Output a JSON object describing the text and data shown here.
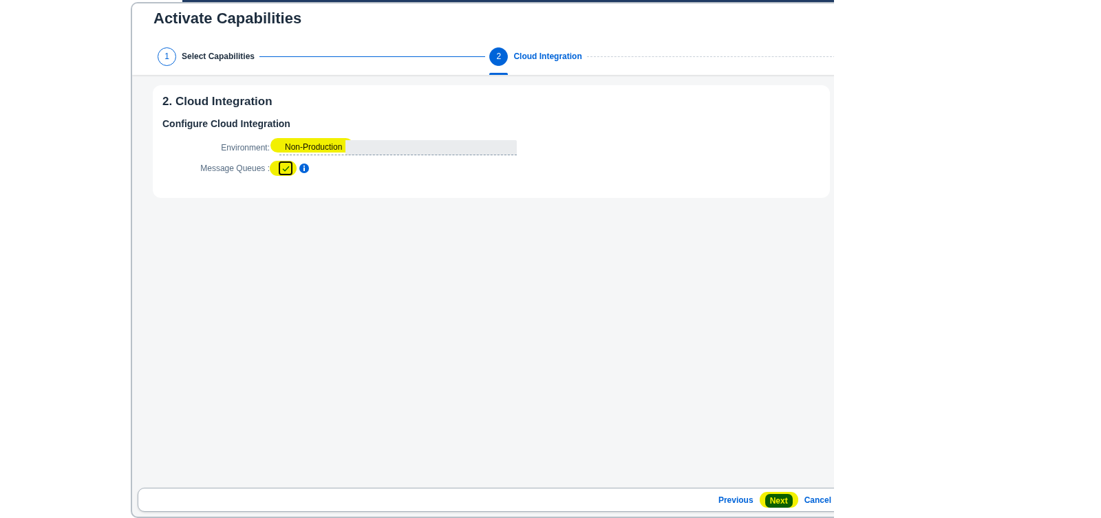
{
  "dialog": {
    "title": "Activate Capabilities"
  },
  "wizard": {
    "steps": [
      {
        "number": "1",
        "label": "Select Capabilities",
        "selected": false
      },
      {
        "number": "2",
        "label": "Cloud Integration",
        "selected": true
      }
    ]
  },
  "section": {
    "title": "2. Cloud Integration",
    "subtitle": "Configure Cloud Integration",
    "fields": [
      {
        "kind": "input",
        "label": "Environment:",
        "value": "Non-Production",
        "readonly": true,
        "highlighted": true
      },
      {
        "kind": "checkbox",
        "label": "Message Queues :",
        "checked": true,
        "info": true,
        "highlighted": true
      }
    ]
  },
  "footer": {
    "buttons": [
      {
        "label": "Previous",
        "kind": "transparent",
        "highlighted": false
      },
      {
        "label": "Next",
        "kind": "emphasized",
        "highlighted": true
      },
      {
        "label": "Cancel",
        "kind": "transparent",
        "highlighted": false
      }
    ]
  }
}
